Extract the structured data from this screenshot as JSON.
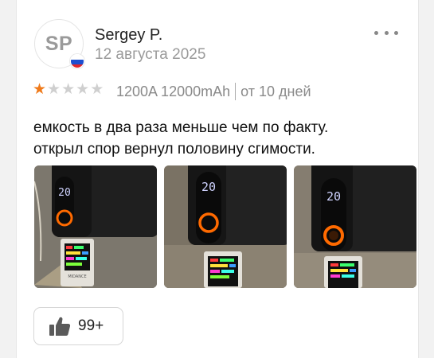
{
  "review": {
    "avatar_initials": "SP",
    "country_flag": "russia-flag",
    "author": "Sergey P.",
    "date": "12 августа 2025",
    "rating": 1,
    "rating_max": 5,
    "variant": "1200A 12000mAh",
    "usage": "от 10 дней",
    "text_line1": "емкость в два раза меньше чем по факту.",
    "text_line2": "открыл спор вернул половину сгимости.",
    "photos": [
      {
        "display_text": "20",
        "tester_label": "MIDANCE"
      },
      {
        "display_text": "20",
        "tester_label": ""
      },
      {
        "display_text": "20",
        "tester_label": ""
      }
    ],
    "like_count": "99+"
  },
  "colors": {
    "star_on": "#ef7a1a",
    "star_off": "#cfcfcf",
    "ring": "#ff6a00",
    "screen_text": "#cfd3ff"
  }
}
